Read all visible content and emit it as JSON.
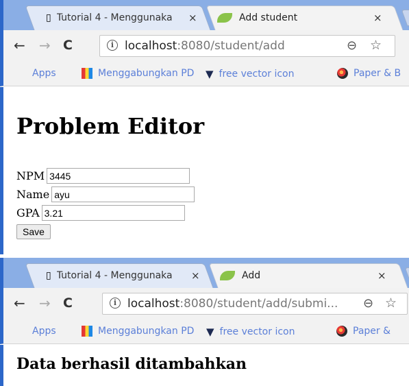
{
  "shot1": {
    "tabs": [
      {
        "title": "Tutorial 4 - Menggunaka",
        "close": "×",
        "active": false
      },
      {
        "title": "Add student",
        "close": "×",
        "active": true
      }
    ],
    "url": {
      "host": "localhost",
      "rest": ":8080/student/add"
    },
    "bookmarks": [
      "Apps",
      "Menggabungkan PDF",
      "free vector icon",
      "Paper & B"
    ],
    "page": {
      "heading": "Problem Editor",
      "fields": [
        {
          "label": "NPM",
          "value": "3445"
        },
        {
          "label": "Name",
          "value": "ayu"
        },
        {
          "label": "GPA",
          "value": "3.21"
        }
      ],
      "save_label": "Save"
    }
  },
  "shot2": {
    "tabs": [
      {
        "title": "Tutorial 4 - Menggunaka",
        "close": "×",
        "active": false
      },
      {
        "title": "Add",
        "close": "×",
        "active": true
      }
    ],
    "url": {
      "host": "localhost",
      "rest": ":8080/student/add/submi..."
    },
    "bookmarks": [
      "Apps",
      "Menggabungkan PDF",
      "free vector icon",
      "Paper &"
    ],
    "page": {
      "message": "Data berhasil ditambahkan"
    }
  },
  "icons": {
    "back": "←",
    "forward": "→",
    "reload": "C",
    "info": "i",
    "zoom": "⊖",
    "star": "☆"
  },
  "colors": {
    "tabstrip": "#8aaee5",
    "window_border": "#2c67c9",
    "bookmark_text": "#5b7fd8"
  }
}
